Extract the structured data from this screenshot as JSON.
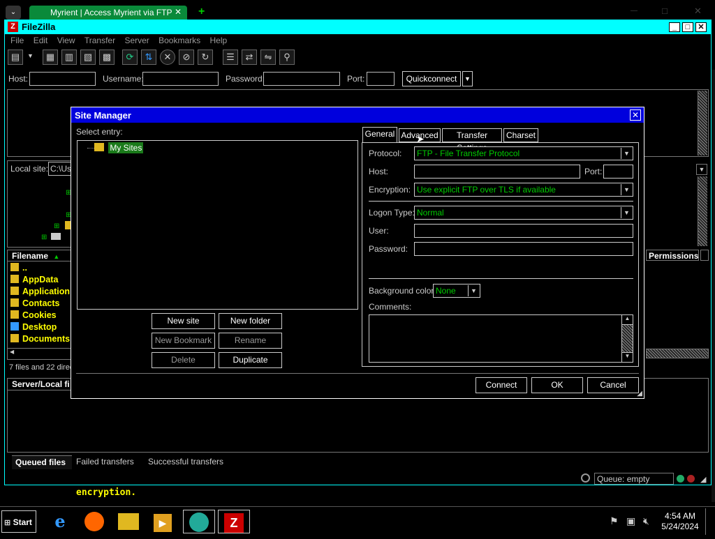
{
  "browser": {
    "tab_title": "Myrient | Access Myrient via FTP",
    "close": "✕",
    "new_tab": "+",
    "min": "—",
    "max": "□",
    "close_win": "✕"
  },
  "window": {
    "title": "FileZilla",
    "btn_min": "_",
    "btn_max": "□",
    "btn_close": "✕"
  },
  "menu": [
    "File",
    "Edit",
    "View",
    "Transfer",
    "Server",
    "Bookmarks",
    "Help"
  ],
  "quickconnect": {
    "host_label": "Host:",
    "host_value": "",
    "username_label": "Username:",
    "username_value": "",
    "password_label": "Password:",
    "password_value": "",
    "port_label": "Port:",
    "port_value": "",
    "button": "Quickconnect"
  },
  "local_site": {
    "label": "Local site:",
    "path": "C:\\Us"
  },
  "file_list": {
    "header_filename": "Filename",
    "header_permissions": "Permissions",
    "rows": [
      "..",
      "AppData",
      "Application",
      "Contacts",
      "Cookies",
      "Desktop",
      "Documents"
    ],
    "status": "7 files and 22 direc"
  },
  "queue_header": "Server/Local fi",
  "queue_tabs": [
    "Queued files",
    "Failed transfers",
    "Successful transfers"
  ],
  "queue_status": "Queue: empty",
  "terminal_text": "encryption.",
  "site_manager": {
    "title": "Site Manager",
    "close": "✕",
    "select_entry_label": "Select entry:",
    "tree_root": "My Sites",
    "buttons": {
      "new_site": "New site",
      "new_folder": "New folder",
      "new_bookmark": "New Bookmark",
      "rename": "Rename",
      "delete": "Delete",
      "duplicate": "Duplicate",
      "connect": "Connect",
      "ok": "OK",
      "cancel": "Cancel"
    },
    "tabs": [
      "General",
      "Advanced",
      "Transfer Settings",
      "Charset"
    ],
    "general": {
      "protocol_label": "Protocol:",
      "protocol_value": "FTP - File Transfer Protocol",
      "host_label": "Host:",
      "host_value": "",
      "port_label": "Port:",
      "port_value": "",
      "encryption_label": "Encryption:",
      "encryption_value": "Use explicit FTP over TLS if available",
      "logon_type_label": "Logon Type:",
      "logon_type_value": "Normal",
      "user_label": "User:",
      "user_value": "",
      "password_label": "Password:",
      "password_value": "",
      "background_color_label": "Background color:",
      "background_color_value": "None",
      "comments_label": "Comments:",
      "comments_value": ""
    }
  },
  "taskbar": {
    "start": "Start",
    "time": "4:54 AM",
    "date": "5/24/2024"
  },
  "colors": {
    "accent_cyan": "#00ffff",
    "dialog_title": "#0000dd",
    "value_green": "#00cc00",
    "folder_yellow": "#ffff00",
    "tab_green": "#0a8a3a"
  }
}
